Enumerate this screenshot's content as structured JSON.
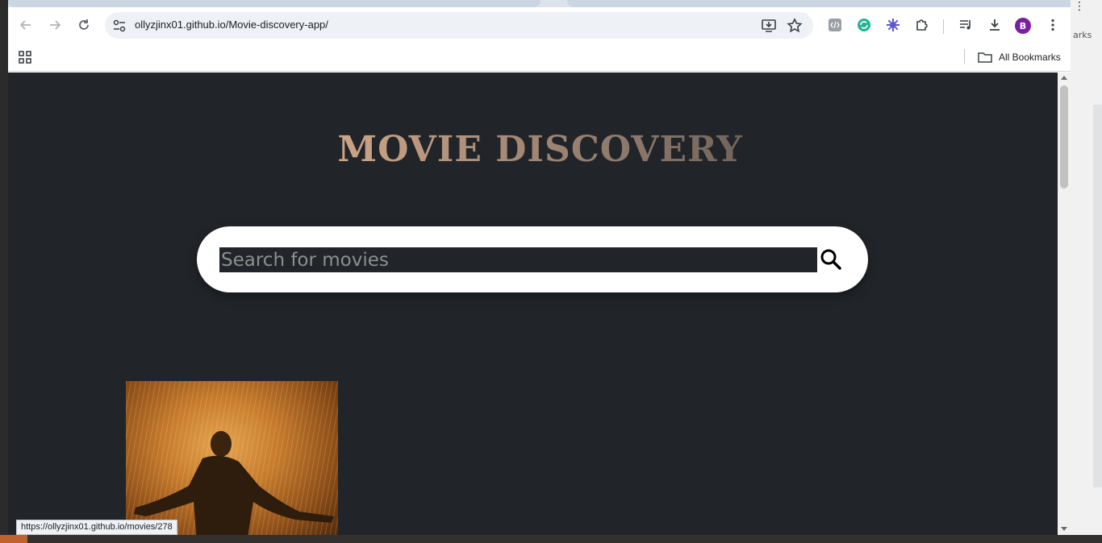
{
  "browser": {
    "url": "ollyzjinx01.github.io/Movie-discovery-app/",
    "bookmarks_label": "All Bookmarks",
    "avatar_initial": "B",
    "status_url": "https://ollyzjinx01.github.io/movies/278"
  },
  "background_window": {
    "menu_glyph": "⋮",
    "partial_text": "arks"
  },
  "page": {
    "title": "MOVIE DISCOVERY",
    "search": {
      "placeholder": "Search for movies",
      "value": ""
    }
  },
  "colors": {
    "page_bg": "#212529",
    "title_gradient_start": "#f3c9a6",
    "avatar": "#7b1fa2"
  }
}
